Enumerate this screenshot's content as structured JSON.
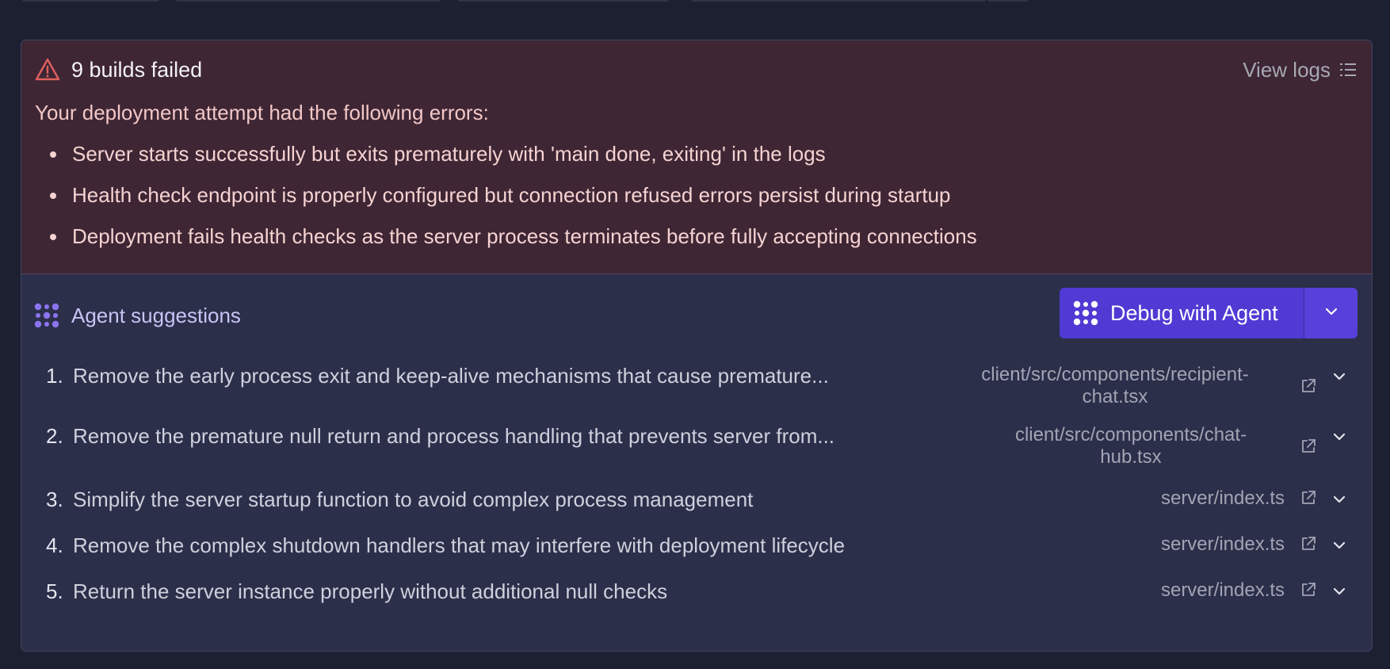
{
  "error_panel": {
    "title": "9 builds failed",
    "view_logs_label": "View logs",
    "intro": "Your deployment attempt had the following errors:",
    "errors": [
      "Server starts successfully but exits prematurely with 'main done, exiting' in the logs",
      "Health check endpoint is properly configured but connection refused errors persist during startup",
      "Deployment fails health checks as the server process terminates before fully accepting connections"
    ],
    "icons": {
      "title": "warning-triangle-icon",
      "view_logs": "list-icon"
    }
  },
  "agent_panel": {
    "title": "Agent suggestions",
    "debug_button_label": "Debug with Agent",
    "icons": {
      "title": "agent-logo-icon",
      "button": "agent-logo-icon",
      "dropdown": "chevron-down-icon"
    },
    "suggestions": [
      {
        "num": "1.",
        "text": "Remove the early process exit and keep-alive mechanisms that cause premature...",
        "file_line1": "client/src/components/recipient-",
        "file_line2": "chat.tsx"
      },
      {
        "num": "2.",
        "text": "Remove the premature null return and process handling that prevents server from...",
        "file_line1": "client/src/components/chat-",
        "file_line2": "hub.tsx"
      },
      {
        "num": "3.",
        "text": "Simplify the server startup function to avoid complex process management",
        "file_line1": "server/index.ts",
        "file_line2": ""
      },
      {
        "num": "4.",
        "text": "Remove the complex shutdown handlers that may interfere with deployment lifecycle",
        "file_line1": "server/index.ts",
        "file_line2": ""
      },
      {
        "num": "5.",
        "text": "Return the server instance properly without additional null checks",
        "file_line1": "server/index.ts",
        "file_line2": ""
      }
    ]
  },
  "colors": {
    "background": "#1c2031",
    "error_bg": "#3e2634",
    "agent_bg": "#2b2f4a",
    "accent": "#4f3ad4",
    "warning": "#e0605f"
  }
}
